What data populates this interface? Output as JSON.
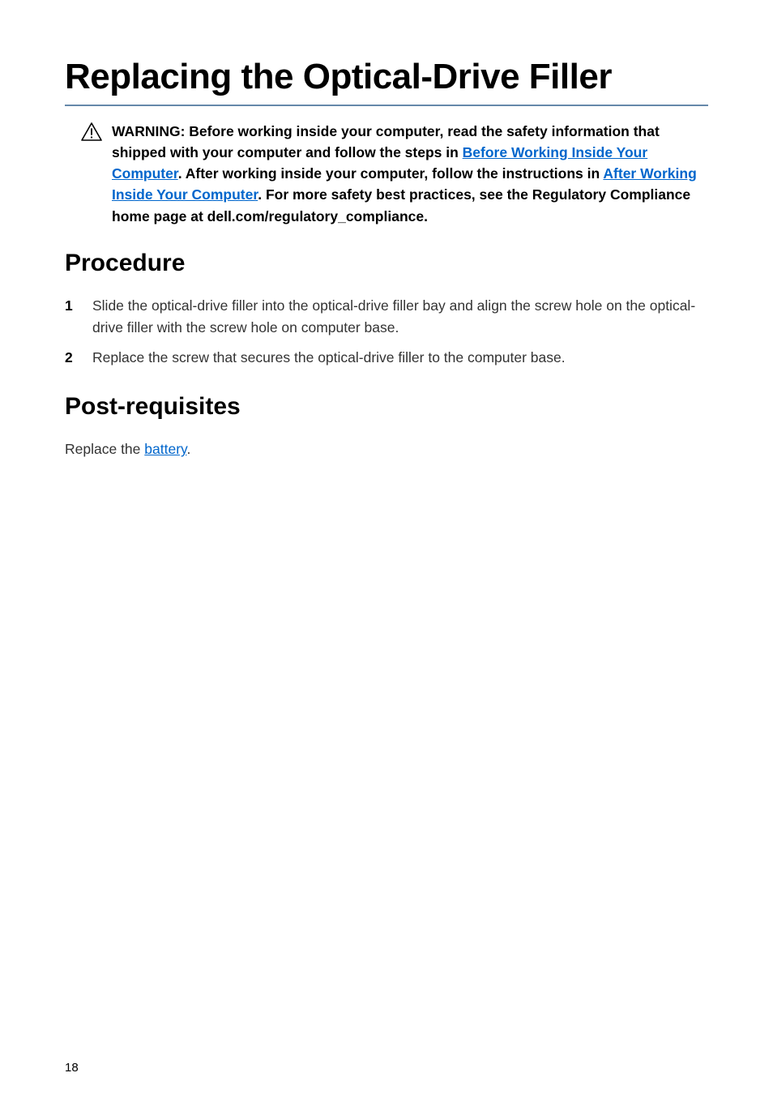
{
  "title": "Replacing the Optical-Drive Filler",
  "warning": {
    "prefix": "WARNING: Before working inside your computer, read the safety information that shipped with your computer and follow the steps in ",
    "link1": "Before Working Inside Your Computer",
    "mid1": ". After working inside your computer, follow the instructions in ",
    "link2": "After Working Inside Your Computer",
    "suffix": ". For more safety best practices, see the Regulatory Compliance home page at dell.com/regulatory_compliance."
  },
  "procedure": {
    "heading": "Procedure",
    "steps": [
      "Slide the optical-drive filler into the optical-drive filler bay and align the screw hole on the optical-drive filler with the screw hole on computer base.",
      "Replace the screw that secures the optical-drive filler to the computer base."
    ]
  },
  "postreq": {
    "heading": "Post-requisites",
    "prefix": "Replace the ",
    "link": "battery",
    "suffix": "."
  },
  "pageNumber": "18"
}
